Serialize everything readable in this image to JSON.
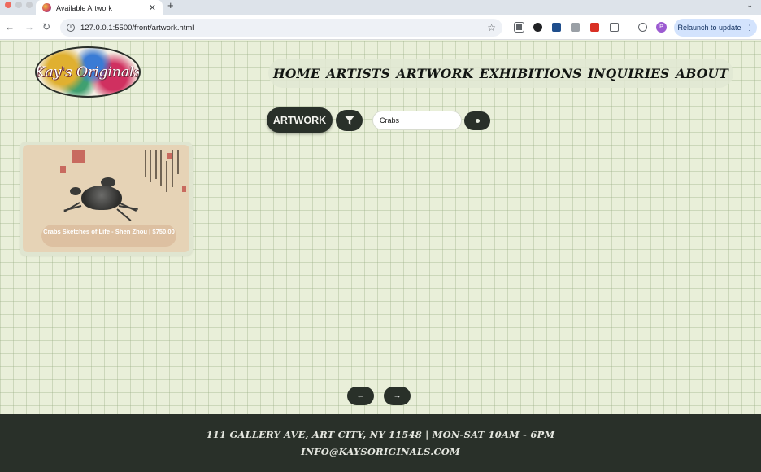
{
  "browser": {
    "tab_title": "Available Artwork",
    "url": "127.0.0.1:5500/front/artwork.html",
    "relaunch_label": "Relaunch to update",
    "profile_initial": "P"
  },
  "site": {
    "logo_text": "Kay's Originals",
    "nav": [
      "HOME",
      "ARTISTS",
      "ARTWORK",
      "EXHIBITIONS",
      "INQUIRIES",
      "ABOUT"
    ]
  },
  "controls": {
    "artwork_label": "ARTWORK",
    "search_value": "Crabs"
  },
  "artworks": [
    {
      "caption": "Crabs Sketches of Life - Shen Zhou | $750.00"
    }
  ],
  "pagination": {
    "prev": "←",
    "next": "→"
  },
  "footer": {
    "address": "111 GALLERY AVE, ART CITY, NY 11548 | MON-SAT 10AM - 6PM",
    "email": "INFO@KAYSORIGINALS.COM"
  },
  "colors": {
    "page_bg": "#e9efd9",
    "dark": "#293029",
    "caption_bg": "#dcbea0"
  }
}
